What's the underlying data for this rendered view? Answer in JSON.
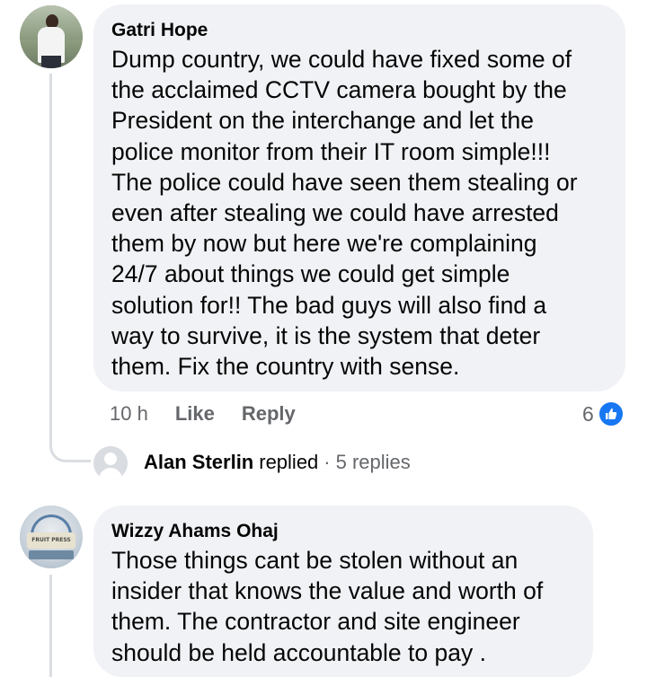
{
  "comments": [
    {
      "author": "Gatri Hope",
      "text": "Dump country, we could have fixed some of\nthe acclaimed CCTV camera bought by the\nPresident on the interchange and let the\npolice monitor from their IT room simple!!!\nThe police could have seen them stealing or\neven after stealing we could have arrested\nthem by now but here we're complaining\n24/7 about things we could get simple\nsolution for!! The bad guys will also find a\nway to survive, it is the system that deter\nthem. Fix the country with sense.",
      "time": "10 h",
      "like_label": "Like",
      "reply_label": "Reply",
      "reaction_count": "6",
      "reaction_icon": "thumbs-up-icon",
      "reaction_color": "#1877f2"
    },
    {
      "author": "Wizzy Ahams Ohaj",
      "avatar_sign_text": "FRUIT PRESS",
      "text": "Those things cant be stolen without an\ninsider that knows the value and worth of\nthem. The contractor and site engineer\nshould be held accountable to pay ."
    }
  ],
  "replies_summary": {
    "replier": "Alan Sterlin",
    "replied_word": "replied",
    "separator": "·",
    "count_text": "5 replies"
  },
  "colors": {
    "bubble_bg": "#f0f2f5",
    "secondary_text": "#65676b",
    "primary_text": "#050505",
    "thread_line": "#dadde1"
  }
}
